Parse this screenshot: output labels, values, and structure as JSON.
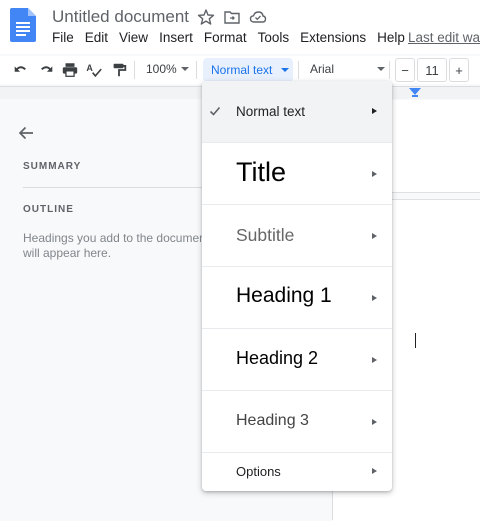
{
  "app": {
    "doc_title": "Untitled document",
    "last_edit": "Last edit was"
  },
  "menubar": [
    "File",
    "Edit",
    "View",
    "Insert",
    "Format",
    "Tools",
    "Extensions",
    "Help"
  ],
  "toolbar": {
    "zoom": "100%",
    "paragraph_style": "Normal text",
    "font": "Arial",
    "font_size": "11",
    "decrease_label": "−",
    "increase_label": "+"
  },
  "sidebar": {
    "summary_heading": "SUMMARY",
    "outline_heading": "OUTLINE",
    "outline_placeholder": "Headings you add to the document will appear here."
  },
  "style_menu": {
    "items": [
      {
        "label": "Normal text",
        "selected": true
      },
      {
        "label": "Title"
      },
      {
        "label": "Subtitle"
      },
      {
        "label": "Heading 1"
      },
      {
        "label": "Heading 2"
      },
      {
        "label": "Heading 3"
      },
      {
        "label": "Options"
      }
    ]
  },
  "colors": {
    "accent": "#1a73e8",
    "selected_bg": "#f1f3f4",
    "docs_blue": "#4285f4"
  }
}
